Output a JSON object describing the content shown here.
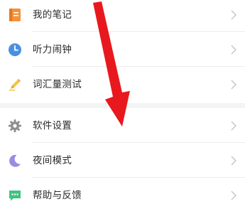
{
  "menu": {
    "items": [
      {
        "label": "我的笔记",
        "icon": "notebook-icon",
        "color": "#f4913c"
      },
      {
        "label": "听力闹钟",
        "icon": "clock-icon",
        "color": "#4a90e2"
      },
      {
        "label": "词汇量测试",
        "icon": "pencil-icon",
        "color": "#f5c542"
      },
      {
        "label": "软件设置",
        "icon": "gear-icon",
        "color": "#8e8e8e"
      },
      {
        "label": "夜间模式",
        "icon": "moon-icon",
        "color": "#9b8ce0"
      },
      {
        "label": "帮助与反馈",
        "icon": "chat-icon",
        "color": "#3fc380"
      }
    ],
    "chevron_color": "#c4c4c4",
    "section_gap_color": "#f4f4f4"
  },
  "overlay": {
    "arrow": "red-arrow-annotation",
    "arrow_color": "#e8191e"
  }
}
